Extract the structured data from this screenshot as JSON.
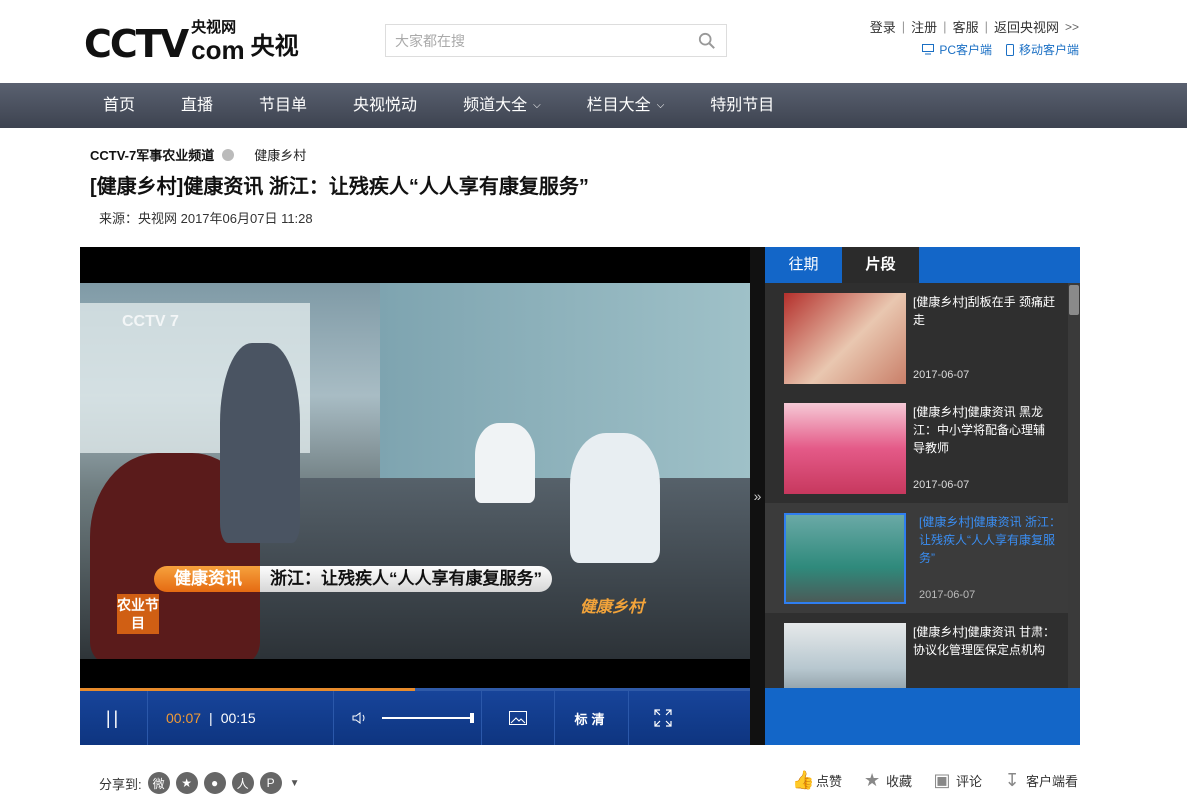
{
  "header": {
    "logo": {
      "cctv": "CCTV",
      "cn_small": "央视网",
      "com": "com",
      "cn_big": "央视"
    },
    "search": {
      "placeholder": "大家都在搜"
    },
    "top_links": [
      "登录",
      "注册",
      "客服",
      "返回央视网"
    ],
    "client_links": [
      "PC客户端",
      "移动客户端"
    ]
  },
  "nav": {
    "items": [
      {
        "label": "首页",
        "dropdown": false
      },
      {
        "label": "直播",
        "dropdown": false
      },
      {
        "label": "节目单",
        "dropdown": false
      },
      {
        "label": "央视悦动",
        "dropdown": false
      },
      {
        "label": "频道大全",
        "dropdown": true
      },
      {
        "label": "栏目大全",
        "dropdown": true
      },
      {
        "label": "特别节目",
        "dropdown": false
      }
    ]
  },
  "article": {
    "channel": "CCTV-7军事农业频道",
    "column": "健康乡村",
    "title": "[健康乡村]健康资讯 浙江：让残疾人“人人享有康复服务”",
    "source": "来源：央视网 2017年06月07日 11:28"
  },
  "player": {
    "watermark": "CCTV 7",
    "caption_a": "健康资讯",
    "caption_b": "浙江：让残疾人“人人享有康复服务”",
    "channel_tag": "农业节目",
    "show_logo": "健康乡村",
    "current_time": "00:07",
    "duration": "00:15",
    "progress": 0.5,
    "volume": 1.0,
    "quality_label": "标清",
    "colors": {
      "control_bar": "#0e3580",
      "progress_fill": "#e78b2c",
      "current_time": "#f19a35"
    }
  },
  "side_panel": {
    "tabs": [
      {
        "label": "往期",
        "active": false
      },
      {
        "label": "片段",
        "active": true
      }
    ],
    "items": [
      {
        "title": "[健康乡村]刮板在手 颈痛赶走",
        "date": "2017-06-07",
        "current": false
      },
      {
        "title": "[健康乡村]健康资讯 黑龙江：中小学将配备心理辅导教师",
        "date": "2017-06-07",
        "current": false
      },
      {
        "title": "[健康乡村]健康资讯 浙江：让残疾人“人人享有康复服务”",
        "date": "2017-06-07",
        "current": true
      },
      {
        "title": "[健康乡村]健康资讯 甘肃：协议化管理医保定点机构",
        "date": "",
        "current": false
      }
    ],
    "colors": {
      "accent": "#1366c8",
      "current_title": "#3a8ef3"
    }
  },
  "share": {
    "label": "分享到:",
    "icons": [
      "weibo-icon",
      "qzone-icon",
      "wechat-icon",
      "renren-icon",
      "pinterest-icon"
    ]
  },
  "actions": [
    "点赞",
    "收藏",
    "评论",
    "客户端看"
  ]
}
